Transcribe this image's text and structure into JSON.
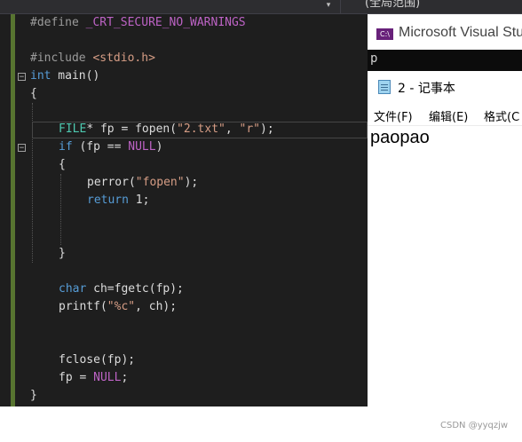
{
  "toolbar": {
    "dropdown_arrow": "▾",
    "scope_label": "(全局范围)"
  },
  "editor": {
    "colors": {
      "background": "#1e1e1e",
      "keyword": "#569cd6",
      "type": "#4ec9b0",
      "string": "#d69d85",
      "macro": "#bd63c5",
      "preprocessor": "#9b9b9b",
      "text": "#dcdcdc",
      "change_bar": "#577430"
    },
    "lines": [
      [
        {
          "t": "#define ",
          "c": "preprocessor"
        },
        {
          "t": "_CRT_SECURE_NO_WARNINGS",
          "c": "macro"
        }
      ],
      [],
      [
        {
          "t": "#include ",
          "c": "preprocessor"
        },
        {
          "t": "<stdio.h>",
          "c": "string"
        }
      ],
      [
        {
          "t": "int",
          "c": "keyword"
        },
        {
          "t": " main()",
          "c": "text"
        }
      ],
      [
        {
          "t": "{",
          "c": "text"
        }
      ],
      [],
      [
        {
          "t": "FILE",
          "c": "type"
        },
        {
          "t": "* fp = fopen(",
          "c": "text"
        },
        {
          "t": "\"2.txt\"",
          "c": "string"
        },
        {
          "t": ", ",
          "c": "text"
        },
        {
          "t": "\"r\"",
          "c": "string"
        },
        {
          "t": ");",
          "c": "text"
        }
      ],
      [
        {
          "t": "if",
          "c": "keyword"
        },
        {
          "t": " (fp == ",
          "c": "text"
        },
        {
          "t": "NULL",
          "c": "macro"
        },
        {
          "t": ")",
          "c": "text"
        }
      ],
      [
        {
          "t": "{",
          "c": "text"
        }
      ],
      [
        {
          "t": "perror(",
          "c": "text"
        },
        {
          "t": "\"fopen\"",
          "c": "string"
        },
        {
          "t": ");",
          "c": "text"
        }
      ],
      [
        {
          "t": "return",
          "c": "keyword"
        },
        {
          "t": " 1;",
          "c": "text"
        }
      ],
      [],
      [],
      [
        {
          "t": "}",
          "c": "text"
        }
      ],
      [],
      [
        {
          "t": "char",
          "c": "keyword"
        },
        {
          "t": " ch=fgetc(fp);",
          "c": "text"
        }
      ],
      [
        {
          "t": "printf(",
          "c": "text"
        },
        {
          "t": "\"%c\"",
          "c": "string"
        },
        {
          "t": ", ch);",
          "c": "text"
        }
      ],
      [],
      [],
      [
        {
          "t": "fclose(fp);",
          "c": "text"
        }
      ],
      [
        {
          "t": "fp = ",
          "c": "text"
        },
        {
          "t": "NULL",
          "c": "macro"
        },
        {
          "t": ";",
          "c": "text"
        }
      ],
      [
        {
          "t": "}",
          "c": "text"
        }
      ]
    ]
  },
  "vs_window": {
    "logo_text": "C:\\",
    "title": "Microsoft Visual Stu"
  },
  "console": {
    "output": "p"
  },
  "notepad": {
    "title": "2 - 记事本",
    "menu": [
      "文件(F)",
      "编辑(E)",
      "格式(C"
    ],
    "content": "paopao"
  },
  "watermark": "CSDN @yyqzjw"
}
